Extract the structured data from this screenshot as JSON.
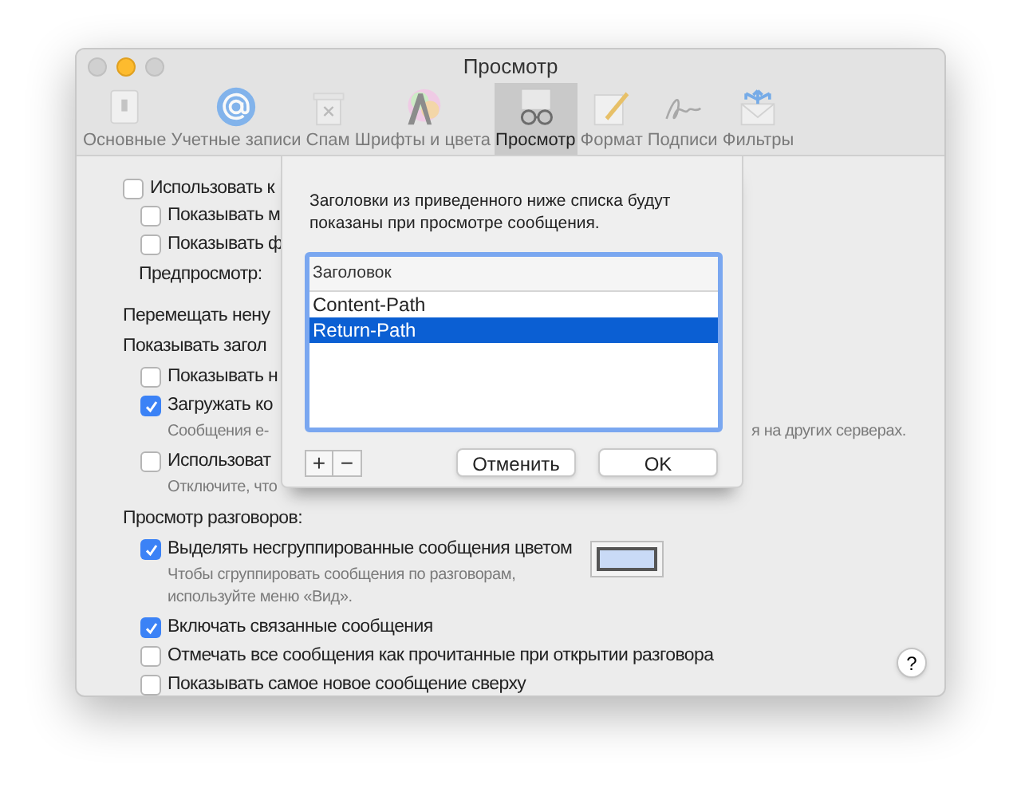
{
  "window": {
    "title": "Просмотр"
  },
  "toolbar": {
    "tabs": [
      {
        "label": "Основные",
        "selected": false
      },
      {
        "label": "Учетные записи",
        "selected": false
      },
      {
        "label": "Спам",
        "selected": false
      },
      {
        "label": "Шрифты и цвета",
        "selected": false
      },
      {
        "label": "Просмотр",
        "selected": true
      },
      {
        "label": "Формат",
        "selected": false
      },
      {
        "label": "Подписи",
        "selected": false
      },
      {
        "label": "Фильтры",
        "selected": false
      }
    ]
  },
  "settings": [
    {
      "kind": "checkbox",
      "label": "Использовать к",
      "checked": false,
      "children": [
        {
          "kind": "checkbox",
          "label": "Показывать м",
          "checked": false
        },
        {
          "kind": "checkbox",
          "label": "Показывать ф",
          "checked": false
        },
        {
          "kind": "label",
          "label": "Предпросмотр:"
        }
      ]
    },
    {
      "kind": "heading",
      "label": "Перемещать нену"
    },
    {
      "kind": "heading",
      "label": "Показывать загол",
      "children": [
        {
          "kind": "checkbox",
          "label": "Показывать н",
          "checked": false
        },
        {
          "kind": "checkbox",
          "label": "Загружать ко",
          "checked": true,
          "hint": [
            "Сообщения e-"
          ],
          "hint_right": "я на других серверах."
        },
        {
          "kind": "checkbox",
          "label": "Использоват",
          "checked": false,
          "hint": [
            "Отключите, что"
          ]
        }
      ]
    },
    {
      "kind": "heading",
      "label": "Просмотр разговоров:",
      "children": [
        {
          "kind": "checkbox",
          "label": "Выделять несгруппированные сообщения цветом",
          "checked": true,
          "color": "#c9daf6",
          "hint": [
            "Чтобы сгруппировать сообщения по разговорам,",
            "используйте меню «Вид»."
          ]
        },
        {
          "kind": "checkbox",
          "label": "Включать связанные сообщения",
          "checked": true
        },
        {
          "kind": "checkbox",
          "label": "Отмечать все сообщения как прочитанные при открытии разговора",
          "checked": false
        },
        {
          "kind": "checkbox",
          "label": "Показывать самое новое сообщение сверху",
          "checked": false
        }
      ]
    }
  ],
  "help": "?",
  "sheet": {
    "message": "Заголовки из приведенного ниже списка будут показаны при просмотре сообщения.",
    "table": {
      "column": "Заголовок",
      "rows": [
        {
          "text": "Content-Path",
          "selected": false
        },
        {
          "text": "Return-Path",
          "selected": true
        }
      ]
    },
    "add": "+",
    "remove": "−",
    "buttons": [
      "Отменить",
      "OK"
    ]
  }
}
